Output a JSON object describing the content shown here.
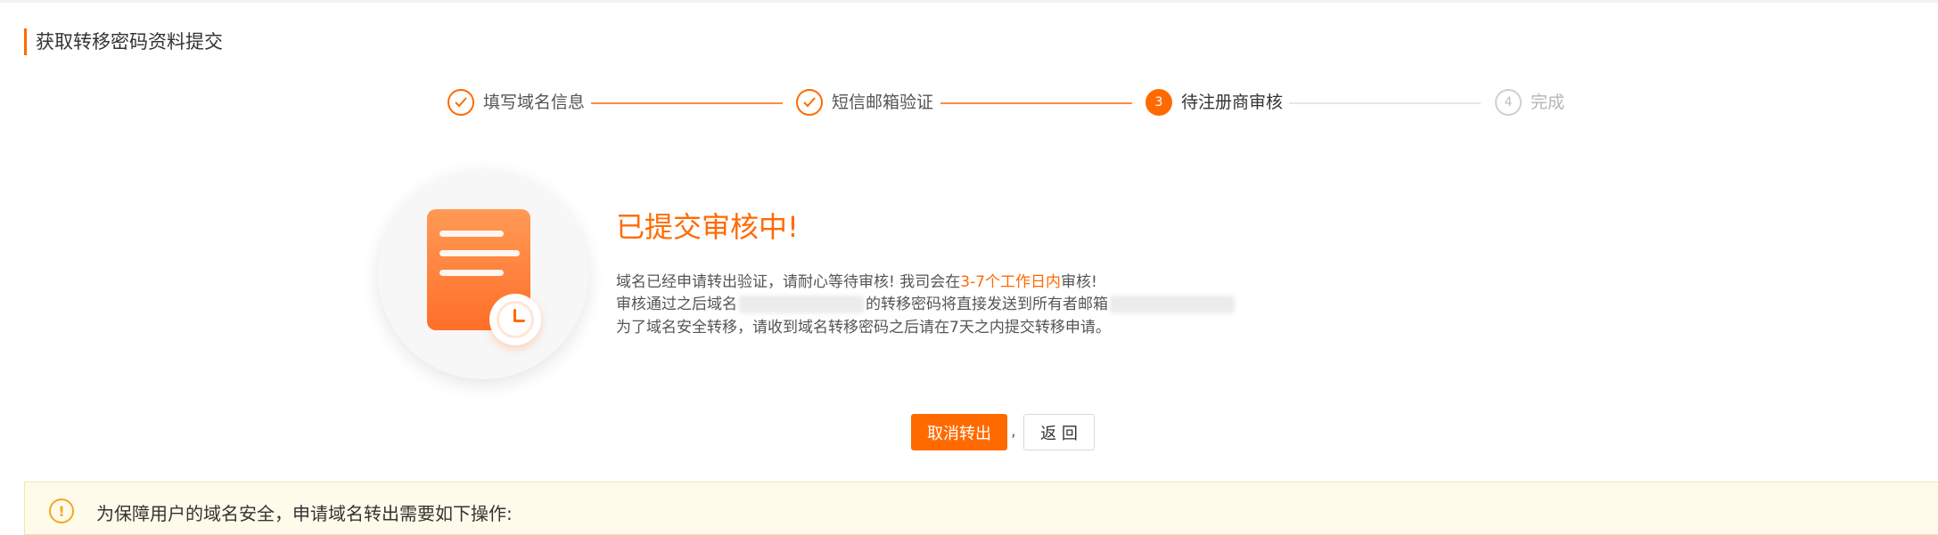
{
  "page": {
    "title": "获取转移密码资料提交"
  },
  "steps": [
    {
      "number": "1",
      "label": "填写域名信息",
      "state": "done"
    },
    {
      "number": "2",
      "label": "短信邮箱验证",
      "state": "done"
    },
    {
      "number": "3",
      "label": "待注册商审核",
      "state": "current"
    },
    {
      "number": "4",
      "label": "完成",
      "state": "todo"
    }
  ],
  "result": {
    "title": "已提交审核中!",
    "line1_prefix": "域名已经申请转出验证，请耐心等待审核! 我司会在",
    "line1_highlight": "3-7个工作日内",
    "line1_suffix": "审核!",
    "line2_prefix": "审核通过之后域名",
    "line2_middle": "的转移密码将直接发送到所有者邮箱",
    "line3": "为了域名安全转移，请收到域名转移密码之后请在7天之内提交转移申请。"
  },
  "actions": {
    "cancel_label": "取消转出",
    "separator": ",",
    "back_label": "返 回"
  },
  "notice": {
    "icon": "!",
    "text": "为保障用户的域名安全，申请域名转出需要如下操作:"
  },
  "colors": {
    "accent": "#ff6a00",
    "notice_bg": "#fffbea",
    "notice_icon": "#f5a623"
  }
}
